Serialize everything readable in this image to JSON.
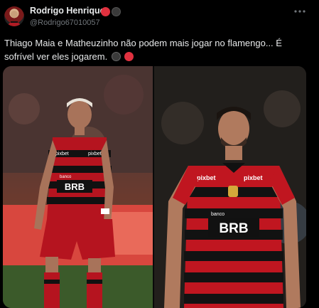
{
  "tweet": {
    "author_name": "Rodrigo Henrique",
    "author_handle": "@Rodrigo67010057",
    "more_icon": "more-icon",
    "text": "Thiago Maia e  Matheuzinho não podem mais jogar no flamengo... É sofrível ver eles jogarem.",
    "media": {
      "left_photo": {
        "sponsor_top": "pixbet",
        "sponsor_chest": "BRB",
        "sponsor_small": "banco"
      },
      "right_photo": {
        "sponsor_top": "pixbet",
        "sponsor_chest": "BRB",
        "sponsor_small": "banco",
        "side_text": "pixbet"
      }
    }
  },
  "colors": {
    "background": "#000000",
    "text": "#e7e9ea",
    "secondary_text": "#71767b",
    "flamengo_red": "#c8102e",
    "flamengo_black": "#111111"
  }
}
